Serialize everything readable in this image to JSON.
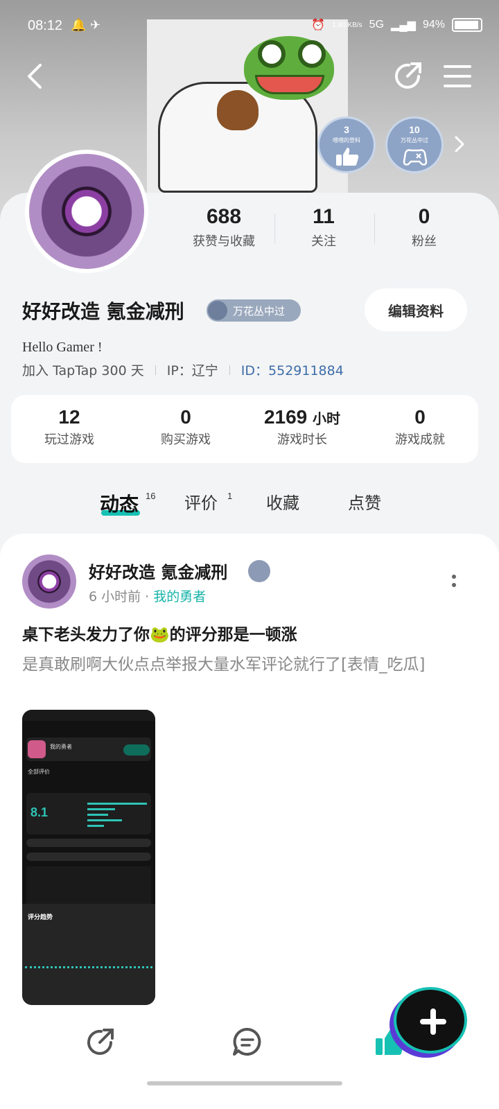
{
  "status_bar": {
    "time": "08:12",
    "speed": "1.90 KB/s",
    "network": "5G",
    "battery_percent": "94%",
    "battery_level": 0.94
  },
  "nav": {
    "back_icon": "chevron-left-icon",
    "share_icon": "share-icon",
    "menu_icon": "hamburger-menu-icon"
  },
  "badges": [
    {
      "number": "3",
      "label": "喂喂的登科",
      "icon": "thumbs-up-icon"
    },
    {
      "number": "10",
      "label": "万花丛中过",
      "icon": "gamepad-icon"
    }
  ],
  "profile": {
    "stats": [
      {
        "value": "688",
        "label": "获赞与收藏"
      },
      {
        "value": "11",
        "label": "关注"
      },
      {
        "value": "0",
        "label": "粉丝"
      }
    ],
    "name": "好好改造 氪金减刑",
    "honor_tag": "万花丛中过",
    "edit_button": "编辑资料",
    "bio": "Hello Gamer !",
    "joined": "加入 TapTap 300 天",
    "ip": "IP：辽宁",
    "id": "ID：552911884"
  },
  "game_stats": [
    {
      "value": "12",
      "unit": "",
      "label": "玩过游戏"
    },
    {
      "value": "0",
      "unit": "",
      "label": "购买游戏"
    },
    {
      "value": "2169",
      "unit": "小时",
      "label": "游戏时长"
    },
    {
      "value": "0",
      "unit": "",
      "label": "游戏成就"
    }
  ],
  "tabs": [
    {
      "label": "动态",
      "count": "16",
      "active": true
    },
    {
      "label": "评价",
      "count": "1",
      "active": false
    },
    {
      "label": "收藏",
      "count": "",
      "active": false
    },
    {
      "label": "点赞",
      "count": "",
      "active": false
    }
  ],
  "post": {
    "author": "好好改造 氪金减刑",
    "time": "6 小时前 ·",
    "game": "我的勇者",
    "title": "桌下老头发力了你🐸的评分那是一顿涨",
    "body": "是真敢刷啊大伙点点举报大量水军评论就行了[表情_吃瓜]",
    "image": {
      "game_name": "我的勇者",
      "section": "全部评价",
      "score": "8.1",
      "chart_title": "评分趋势"
    }
  },
  "actions": {
    "share_icon": "share-icon",
    "comment_icon": "comment-icon",
    "like_icon": "thumbs-up-icon",
    "fab_icon": "plus-icon"
  },
  "colors": {
    "accent": "#16c1b4",
    "id_link": "#3e6da8",
    "badge": "#8ea4c6"
  }
}
